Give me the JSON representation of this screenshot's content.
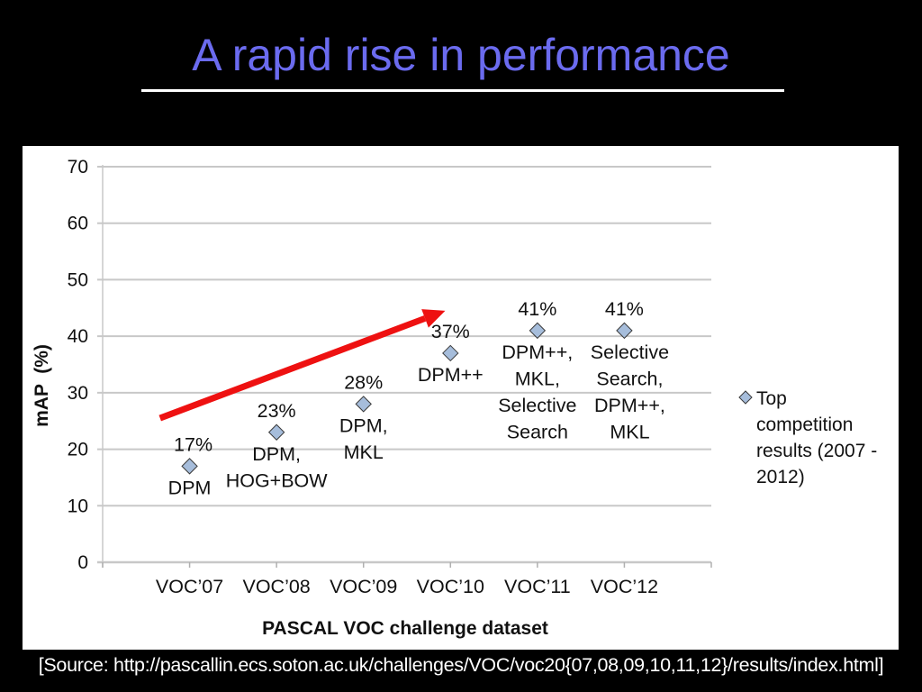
{
  "slide": {
    "title": "A rapid rise in performance",
    "source": "[Source: http://pascallin.ecs.soton.ac.uk/challenges/VOC/voc20{07,08,09,10,11,12}/results/index.html]"
  },
  "colors": {
    "background": "#000000",
    "title": "#6b6bef",
    "marker_fill": "#a6bddb",
    "marker_stroke": "#3a3a3a",
    "trend_arrow": "#ee1111",
    "gridline": "#c8c8c8"
  },
  "chart_data": {
    "type": "scatter",
    "title": "",
    "xlabel": "PASCAL VOC challenge dataset",
    "ylabel": "mAP  (%)",
    "ylim": [
      0,
      70
    ],
    "yticks": [
      0,
      10,
      20,
      30,
      40,
      50,
      60,
      70
    ],
    "xlim": [
      0,
      7
    ],
    "grid": true,
    "legend": {
      "position": "right",
      "entries": [
        "Top competition results (2007 - 2012)"
      ],
      "lines": [
        "Top",
        "competition",
        "results (2007 -",
        "2012)"
      ]
    },
    "categories": [
      "VOC’07",
      "VOC’08",
      "VOC’09",
      "VOC’10",
      "VOC’11",
      "VOC’12"
    ],
    "series": [
      {
        "name": "Top competition results (2007 - 2012)",
        "x": [
          1,
          2,
          3,
          4,
          5,
          6
        ],
        "values": [
          17,
          23,
          28,
          37,
          41,
          41
        ]
      }
    ],
    "point_labels": [
      {
        "value_label": "17%",
        "method_lines": [
          "DPM"
        ]
      },
      {
        "value_label": "23%",
        "method_lines": [
          "DPM,",
          "HOG+BOW"
        ]
      },
      {
        "value_label": "28%",
        "method_lines": [
          "DPM,",
          "MKL"
        ]
      },
      {
        "value_label": "37%",
        "method_lines": [
          "DPM++"
        ]
      },
      {
        "value_label": "41%",
        "method_lines": [
          "DPM++,",
          "MKL,",
          "Selective",
          "Search"
        ]
      },
      {
        "value_label": "41%",
        "method_lines": [
          "Selective",
          "Search,",
          "DPM++,",
          "MKL"
        ]
      }
    ],
    "annotations": [
      {
        "type": "arrow",
        "description": "red trend arrow indicating rising performance",
        "from": [
          0.66,
          25.5
        ],
        "to": [
          3.94,
          44.5
        ]
      }
    ]
  }
}
